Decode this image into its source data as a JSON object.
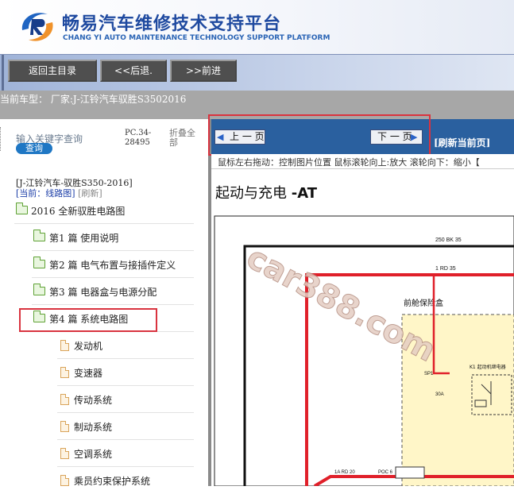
{
  "header": {
    "title_cn": "畅易汽车维修技术支持平台",
    "title_en": "CHANG YI AUTO MAINTENANCE TECHNOLOGY SUPPORT PLATFORM",
    "logo_icon": "blue-orange-swirl-logo"
  },
  "toolbar": {
    "home_label": "返回主目录",
    "back_label": "<<后退.",
    "forward_label": ">>前进"
  },
  "vehicle": {
    "label": "当前车型： 厂家:J-江铃汽车驭胜S3502016"
  },
  "left_panel": {
    "search_placeholder": "输入关键字查询",
    "search_button": "查询",
    "pc_code": "PC.34-28495",
    "collapse_all": "折叠全部",
    "tree_vehicle": "[J-江铃汽车-驭胜S350-2016]",
    "tree_location": "[当前：线路图]",
    "tree_refresh": "[刷新]",
    "tree": [
      {
        "label": "2016 全新驭胜电路图",
        "icon": "folder-icon"
      },
      {
        "label": "第1 篇 使用说明",
        "icon": "folder-icon"
      },
      {
        "label": "第2 篇 电气布置与接插件定义",
        "icon": "folder-icon"
      },
      {
        "label": "第3 篇 电器盒与电源分配",
        "icon": "folder-icon"
      },
      {
        "label": "第4 篇 系统电路图",
        "icon": "folder-icon"
      },
      {
        "label": "发动机",
        "icon": "document-icon"
      },
      {
        "label": "变速器",
        "icon": "document-icon"
      },
      {
        "label": "传动系统",
        "icon": "document-icon"
      },
      {
        "label": "制动系统",
        "icon": "document-icon"
      },
      {
        "label": "空调系统",
        "icon": "document-icon"
      },
      {
        "label": "乘员约束保护系统",
        "icon": "document-icon"
      }
    ]
  },
  "nav": {
    "prev_label": "上 一 页",
    "next_label": "下 一 页",
    "refresh_label": "[刷新当前页]",
    "hint": "鼠标左右拖动：控制图片位置  鼠标滚轮向上:放大  滚轮向下：缩小【"
  },
  "diagram": {
    "title_cn": "起动与充电 ",
    "title_suffix": "-AT",
    "wire_1": "250 BK 35",
    "wire_2": "1 RD 35",
    "fuse_box_label": "前舱保险盒",
    "relay_label": "K1 起动机继电器",
    "wire_3": "1A RD 20",
    "wire_4": "POC 6",
    "small_1": "SP1",
    "small_2": "30A",
    "watermark": "car388.com"
  },
  "colors": {
    "toolbar_button": "#4f4f4f",
    "nav_bar": "#2a609f",
    "highlight": "#d9333f",
    "folder_green": "#5fa235",
    "search_button": "#1f77c4",
    "wire_red": "#e0202a",
    "fuse_box_fill": "#fff6c8",
    "watermark": "#c9a79a"
  }
}
